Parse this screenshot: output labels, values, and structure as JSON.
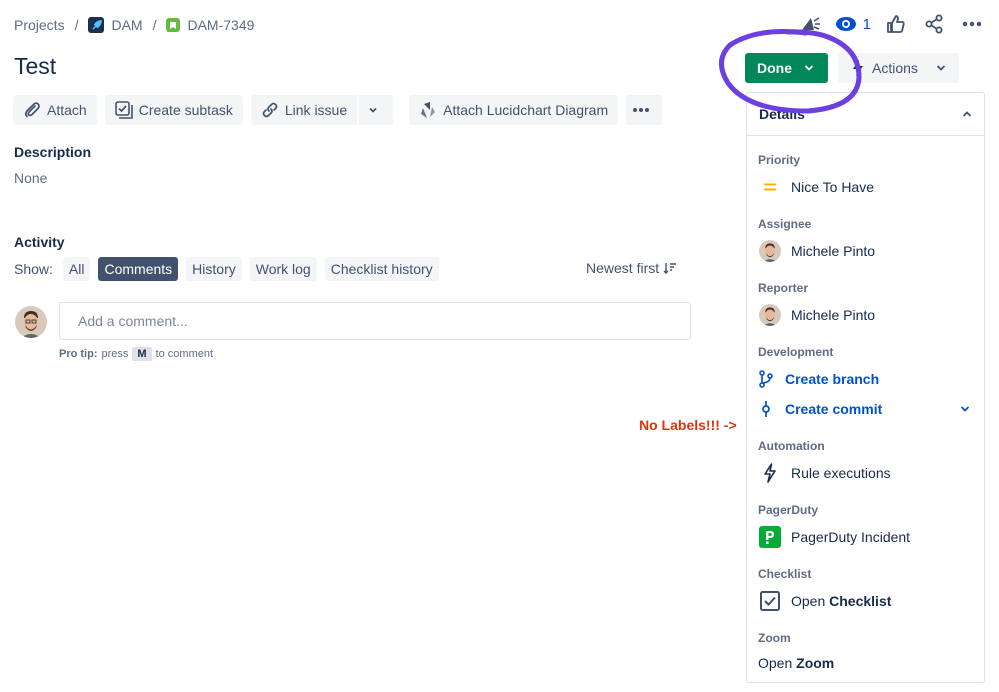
{
  "breadcrumb": {
    "projects": "Projects",
    "sep": "/",
    "project": "DAM",
    "issue_key": "DAM-7349"
  },
  "header": {
    "watch_count": "1",
    "icons": [
      "feedback-icon",
      "eye-icon",
      "thumbs-up-icon",
      "share-icon",
      "more-icon"
    ]
  },
  "issue": {
    "title": "Test",
    "status_button": "Done",
    "actions_button": "Actions"
  },
  "toolbar": {
    "attach": "Attach",
    "create_subtask": "Create subtask",
    "link_issue": "Link issue",
    "lucidchart": "Attach Lucidchart Diagram"
  },
  "description": {
    "heading": "Description",
    "value": "None"
  },
  "activity": {
    "heading": "Activity",
    "show_label": "Show:",
    "filters": [
      "All",
      "Comments",
      "History",
      "Work log",
      "Checklist history"
    ],
    "active_filter": "Comments",
    "sort": "Newest first",
    "comment_placeholder": "Add a comment...",
    "protip_prefix": "Pro tip:",
    "protip_press": "press",
    "protip_key": "M",
    "protip_suffix": "to comment"
  },
  "annotation": "No Labels!!! ->",
  "details": {
    "heading": "Details",
    "priority_label": "Priority",
    "priority_value": "Nice To Have",
    "assignee_label": "Assignee",
    "assignee_value": "Michele Pinto",
    "reporter_label": "Reporter",
    "reporter_value": "Michele Pinto",
    "development_label": "Development",
    "create_branch": "Create branch",
    "create_commit": "Create commit",
    "automation_label": "Automation",
    "automation_value": "Rule executions",
    "pagerduty_label": "PagerDuty",
    "pagerduty_value": "PagerDuty Incident",
    "checklist_label": "Checklist",
    "checklist_open": "Open",
    "checklist_name": "Checklist",
    "zoom_label": "Zoom",
    "zoom_open": "Open",
    "zoom_name": "Zoom"
  },
  "colors": {
    "done_green": "#00875a",
    "link_blue": "#0052cc",
    "annotation_red": "#de350b",
    "highlight_purple": "#6b3fe0",
    "priority_orange": "#ffab00",
    "pagerduty_green": "#06ac38"
  }
}
